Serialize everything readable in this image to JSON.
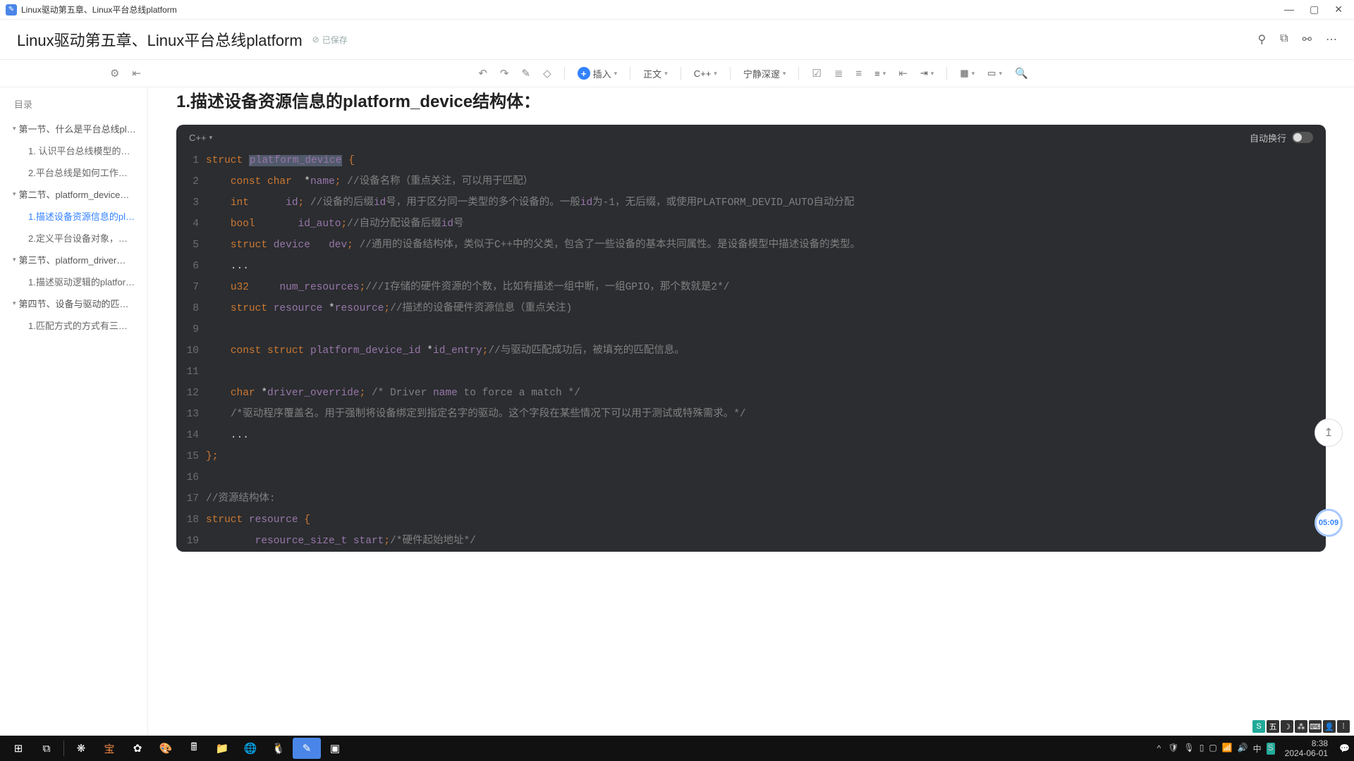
{
  "window": {
    "title": "Linux驱动第五章、Linux平台总线platform"
  },
  "doc": {
    "title": "Linux驱动第五章、Linux平台总线platform",
    "save_status": "已保存"
  },
  "sidebar": {
    "header": "目录",
    "sections": [
      {
        "label": "第一节、什么是平台总线pl…",
        "children": [
          {
            "label": "1. 认识平台总线模型的…"
          },
          {
            "label": "2.平台总线是如何工作…"
          }
        ]
      },
      {
        "label": "第二节、platform_device…",
        "children": [
          {
            "label": "1.描述设备资源信息的pl…",
            "active": true
          },
          {
            "label": "2.定义平台设备对象，…"
          }
        ]
      },
      {
        "label": "第三节、platform_driver…",
        "children": [
          {
            "label": "1.描述驱动逻辑的platfor…"
          }
        ]
      },
      {
        "label": "第四节、设备与驱动的匹…",
        "children": [
          {
            "label": "1.匹配方式的方式有三…"
          }
        ]
      }
    ]
  },
  "toolbar": {
    "insert": "插入",
    "style": "正文",
    "lang": "C++",
    "theme": "宁静深邃"
  },
  "code": {
    "lang": "C++",
    "wrap_label": "自动换行",
    "section_title": "1.描述设备资源信息的platform_device结构体：",
    "lines": [
      "struct platform_device {",
      "    const char  *name; //设备名称（重点关注，可以用于匹配）",
      "    int      id; //设备的后缀id号，用于区分同一类型的多个设备的。一般id为-1，无后缀，或使用PLATFORM_DEVID_AUTO自动分配",
      "    bool       id_auto;//自动分配设备后缀id号",
      "    struct device   dev; //通用的设备结构体，类似于C++中的父类，包含了一些设备的基本共同属性。是设备模型中描述设备的类型。",
      "    ...",
      "    u32     num_resources;///I存储的硬件资源的个数，比如有描述一组中断，一组GPIO，那个数就是2*/",
      "    struct resource *resource;//描述的设备硬件资源信息（重点关注)",
      "",
      "    const struct platform_device_id *id_entry;//与驱动匹配成功后，被填充的匹配信息。",
      "",
      "    char *driver_override; /* Driver name to force a match */",
      "    /*驱动程序覆盖名。用于强制将设备绑定到指定名字的驱动。这个字段在某些情况下可以用于测试或特殊需求。*/",
      "    ...",
      "};",
      "",
      "//资源结构体:",
      "struct resource {",
      "        resource_size_t start;/*硬件起始地址*/"
    ]
  },
  "badge": {
    "time": "05:09"
  },
  "clock": {
    "time": "8:38",
    "date": "2024-06-01"
  },
  "ime": {
    "cells": [
      "S",
      "五",
      "☽",
      "⁂",
      "⌨",
      "👤",
      "⁞"
    ]
  }
}
